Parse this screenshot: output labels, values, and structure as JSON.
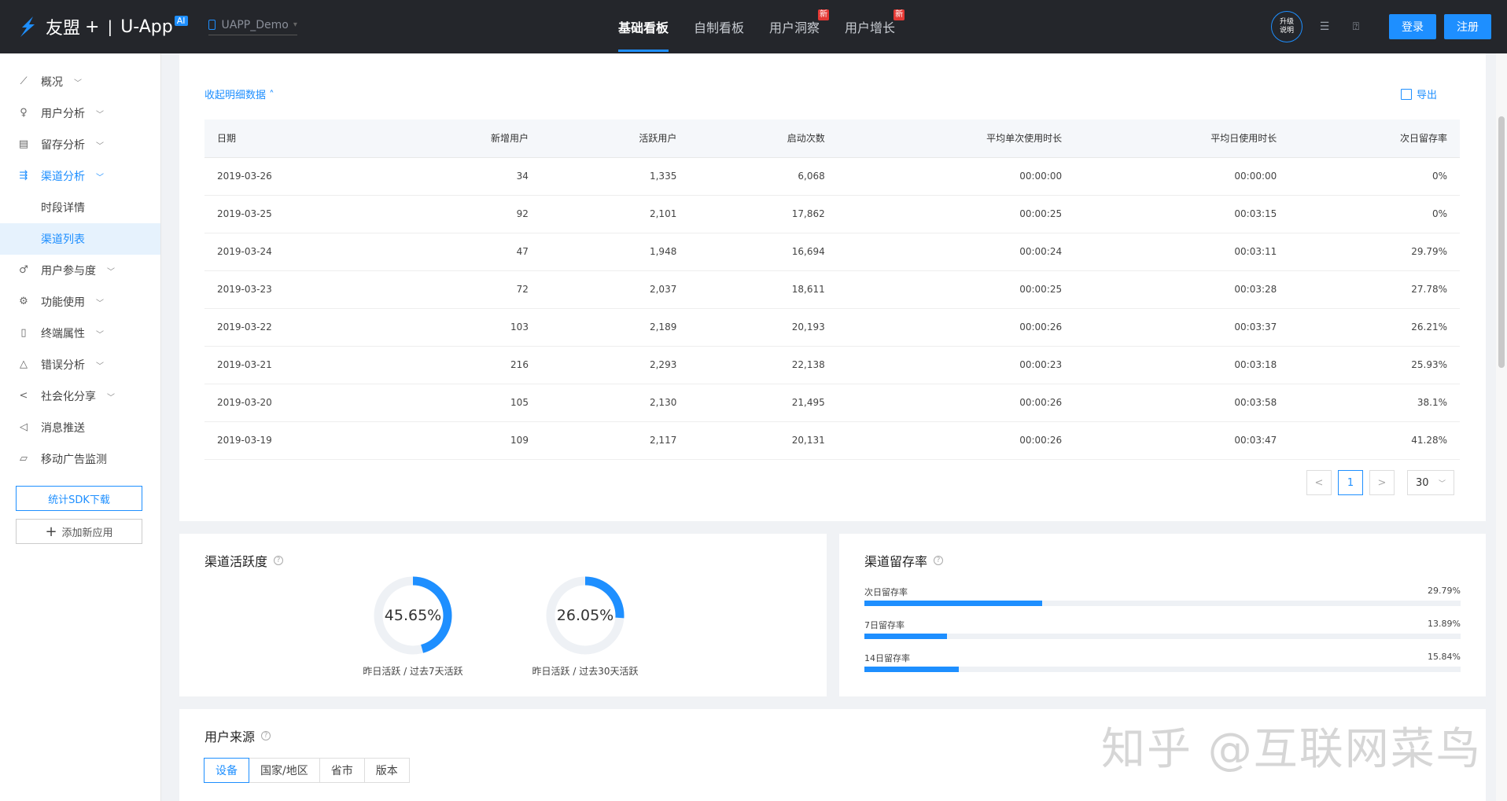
{
  "header": {
    "brand": "友盟",
    "plus": "+",
    "separator": "|",
    "product": "U-App",
    "ai_badge": "AI",
    "app_name": "UAPP_Demo",
    "nav": [
      {
        "label": "基础看板",
        "active": true,
        "badge": ""
      },
      {
        "label": "自制看板",
        "active": false,
        "badge": ""
      },
      {
        "label": "用户洞察",
        "active": false,
        "badge": "新"
      },
      {
        "label": "用户增长",
        "active": false,
        "badge": "新"
      }
    ],
    "upgrade_line1": "升级",
    "upgrade_line2": "说明",
    "login_label": "登录",
    "register_label": "注册"
  },
  "sidebar": {
    "items": [
      {
        "label": "概况",
        "icon": "chart-line-icon"
      },
      {
        "label": "用户分析",
        "icon": "user-icon"
      },
      {
        "label": "留存分析",
        "icon": "calendar-icon"
      },
      {
        "label": "渠道分析",
        "icon": "channel-icon"
      },
      {
        "label": "时段详情"
      },
      {
        "label": "渠道列表"
      },
      {
        "label": "用户参与度",
        "icon": "engagement-icon"
      },
      {
        "label": "功能使用",
        "icon": "gear-icon"
      },
      {
        "label": "终端属性",
        "icon": "device-icon"
      },
      {
        "label": "错误分析",
        "icon": "warning-icon"
      },
      {
        "label": "社会化分享",
        "icon": "share-icon"
      },
      {
        "label": "消息推送",
        "icon": "send-icon"
      },
      {
        "label": "移动广告监测",
        "icon": "ad-monitor-icon"
      }
    ],
    "sdk_button": "统计SDK下载",
    "add_app_button": "添加新应用"
  },
  "detail": {
    "collapse_label": "收起明细数据",
    "export_label": "导出",
    "columns": [
      "日期",
      "新增用户",
      "活跃用户",
      "启动次数",
      "平均单次使用时长",
      "平均日使用时长",
      "次日留存率"
    ],
    "rows": [
      [
        "2019-03-26",
        "34",
        "1,335",
        "6,068",
        "00:00:00",
        "00:00:00",
        "0%"
      ],
      [
        "2019-03-25",
        "92",
        "2,101",
        "17,862",
        "00:00:25",
        "00:03:15",
        "0%"
      ],
      [
        "2019-03-24",
        "47",
        "1,948",
        "16,694",
        "00:00:24",
        "00:03:11",
        "29.79%"
      ],
      [
        "2019-03-23",
        "72",
        "2,037",
        "18,611",
        "00:00:25",
        "00:03:28",
        "27.78%"
      ],
      [
        "2019-03-22",
        "103",
        "2,189",
        "20,193",
        "00:00:26",
        "00:03:37",
        "26.21%"
      ],
      [
        "2019-03-21",
        "216",
        "2,293",
        "22,138",
        "00:00:23",
        "00:03:18",
        "25.93%"
      ],
      [
        "2019-03-20",
        "105",
        "2,130",
        "21,495",
        "00:00:26",
        "00:03:58",
        "38.1%"
      ],
      [
        "2019-03-19",
        "109",
        "2,117",
        "20,131",
        "00:00:26",
        "00:03:47",
        "41.28%"
      ]
    ],
    "pagination": {
      "prev": "<",
      "page": "1",
      "next": ">",
      "page_size": "30"
    }
  },
  "activity": {
    "title": "渠道活跃度",
    "donuts": [
      {
        "value": "45.65%",
        "fraction": 0.4565,
        "label": "昨日活跃 / 过去7天活跃"
      },
      {
        "value": "26.05%",
        "fraction": 0.2605,
        "label": "昨日活跃 / 过去30天活跃"
      }
    ],
    "accent": "#1e8fff"
  },
  "retention": {
    "title": "渠道留存率",
    "bars": [
      {
        "label": "次日留存率",
        "value": "29.79%",
        "fraction": 0.2979
      },
      {
        "label": "7日留存率",
        "value": "13.89%",
        "fraction": 0.1389
      },
      {
        "label": "14日留存率",
        "value": "15.84%",
        "fraction": 0.1584
      }
    ]
  },
  "source": {
    "title": "用户来源",
    "tabs": [
      "设备",
      "国家/地区",
      "省市",
      "版本"
    ],
    "active_tab": 0
  },
  "watermark": "知乎 @互联网菜鸟"
}
